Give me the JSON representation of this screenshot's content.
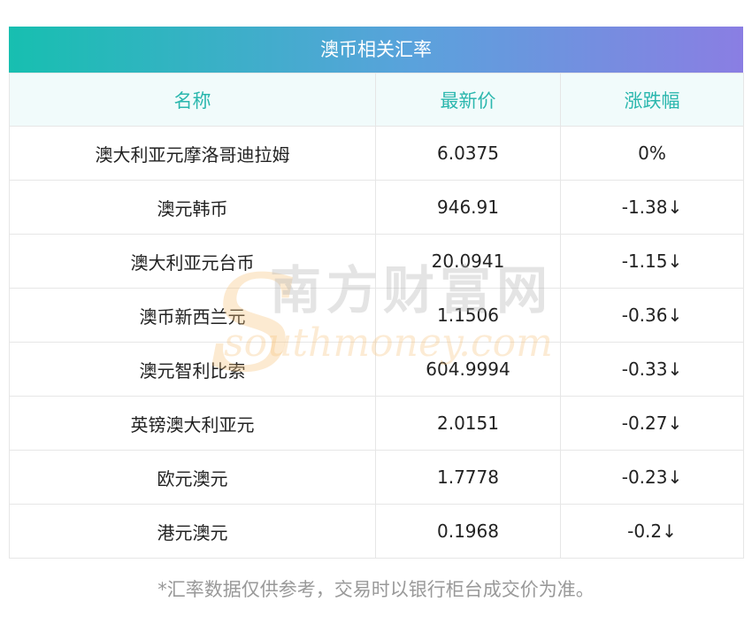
{
  "card": {
    "title": "澳币相关汇率",
    "accent_start": "#17bfb0",
    "accent_end": "#8a7ee3",
    "header_text_color": "#2bb7ae",
    "down_color": "#1f8a1f"
  },
  "table": {
    "columns": [
      "名称",
      "最新价",
      "涨跌幅"
    ],
    "rows": [
      {
        "name": "澳大利亚元摩洛哥迪拉姆",
        "price": "6.0375",
        "change": "0%",
        "direction": "flat"
      },
      {
        "name": "澳元韩币",
        "price": "946.91",
        "change": "-1.38↓",
        "direction": "down"
      },
      {
        "name": "澳大利亚元台币",
        "price": "20.0941",
        "change": "-1.15↓",
        "direction": "down"
      },
      {
        "name": "澳币新西兰元",
        "price": "1.1506",
        "change": "-0.36↓",
        "direction": "down"
      },
      {
        "name": "澳元智利比索",
        "price": "604.9994",
        "change": "-0.33↓",
        "direction": "down"
      },
      {
        "name": "英镑澳大利亚元",
        "price": "2.0151",
        "change": "-0.27↓",
        "direction": "down"
      },
      {
        "name": "欧元澳元",
        "price": "1.7778",
        "change": "-0.23↓",
        "direction": "down"
      },
      {
        "name": "港元澳元",
        "price": "0.1968",
        "change": "-0.2↓",
        "direction": "down"
      }
    ]
  },
  "watermark": {
    "name": "南方财富网",
    "domain": "southmoney.com"
  },
  "footnote": "*汇率数据仅供参考，交易时以银行柜台成交价为准。"
}
